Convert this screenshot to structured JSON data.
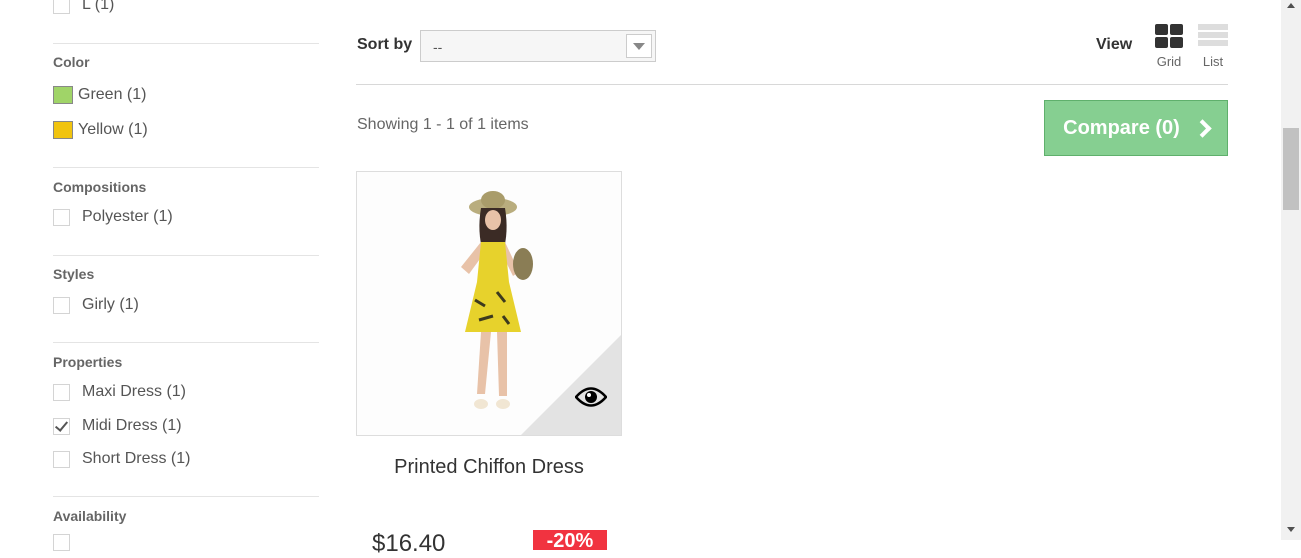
{
  "filters": {
    "size_partial": {
      "label": "L (1)"
    },
    "color": {
      "title": "Color",
      "options": [
        {
          "label": "Green (1)",
          "swatch": "#a0d468"
        },
        {
          "label": "Yellow (1)",
          "swatch": "#f1c40f"
        }
      ]
    },
    "compositions": {
      "title": "Compositions",
      "options": [
        {
          "label": "Polyester (1)",
          "checked": false
        }
      ]
    },
    "styles": {
      "title": "Styles",
      "options": [
        {
          "label": "Girly (1)",
          "checked": false
        }
      ]
    },
    "properties": {
      "title": "Properties",
      "options": [
        {
          "label": "Maxi Dress (1)",
          "checked": false
        },
        {
          "label": "Midi Dress (1)",
          "checked": true
        },
        {
          "label": "Short Dress (1)",
          "checked": false
        }
      ]
    },
    "availability": {
      "title": "Availability"
    }
  },
  "toolbar": {
    "sort_label": "Sort by",
    "sort_value": "--",
    "view_label": "View",
    "view_grid": "Grid",
    "view_list": "List"
  },
  "results": {
    "showing": "Showing 1 - 1 of 1 items",
    "compare_label": "Compare (0)"
  },
  "product": {
    "name": "Printed Chiffon Dress",
    "price": "$16.40",
    "discount": "-20%"
  },
  "colors": {
    "compare_green": "#86cf91",
    "discount_red": "#f13340"
  }
}
